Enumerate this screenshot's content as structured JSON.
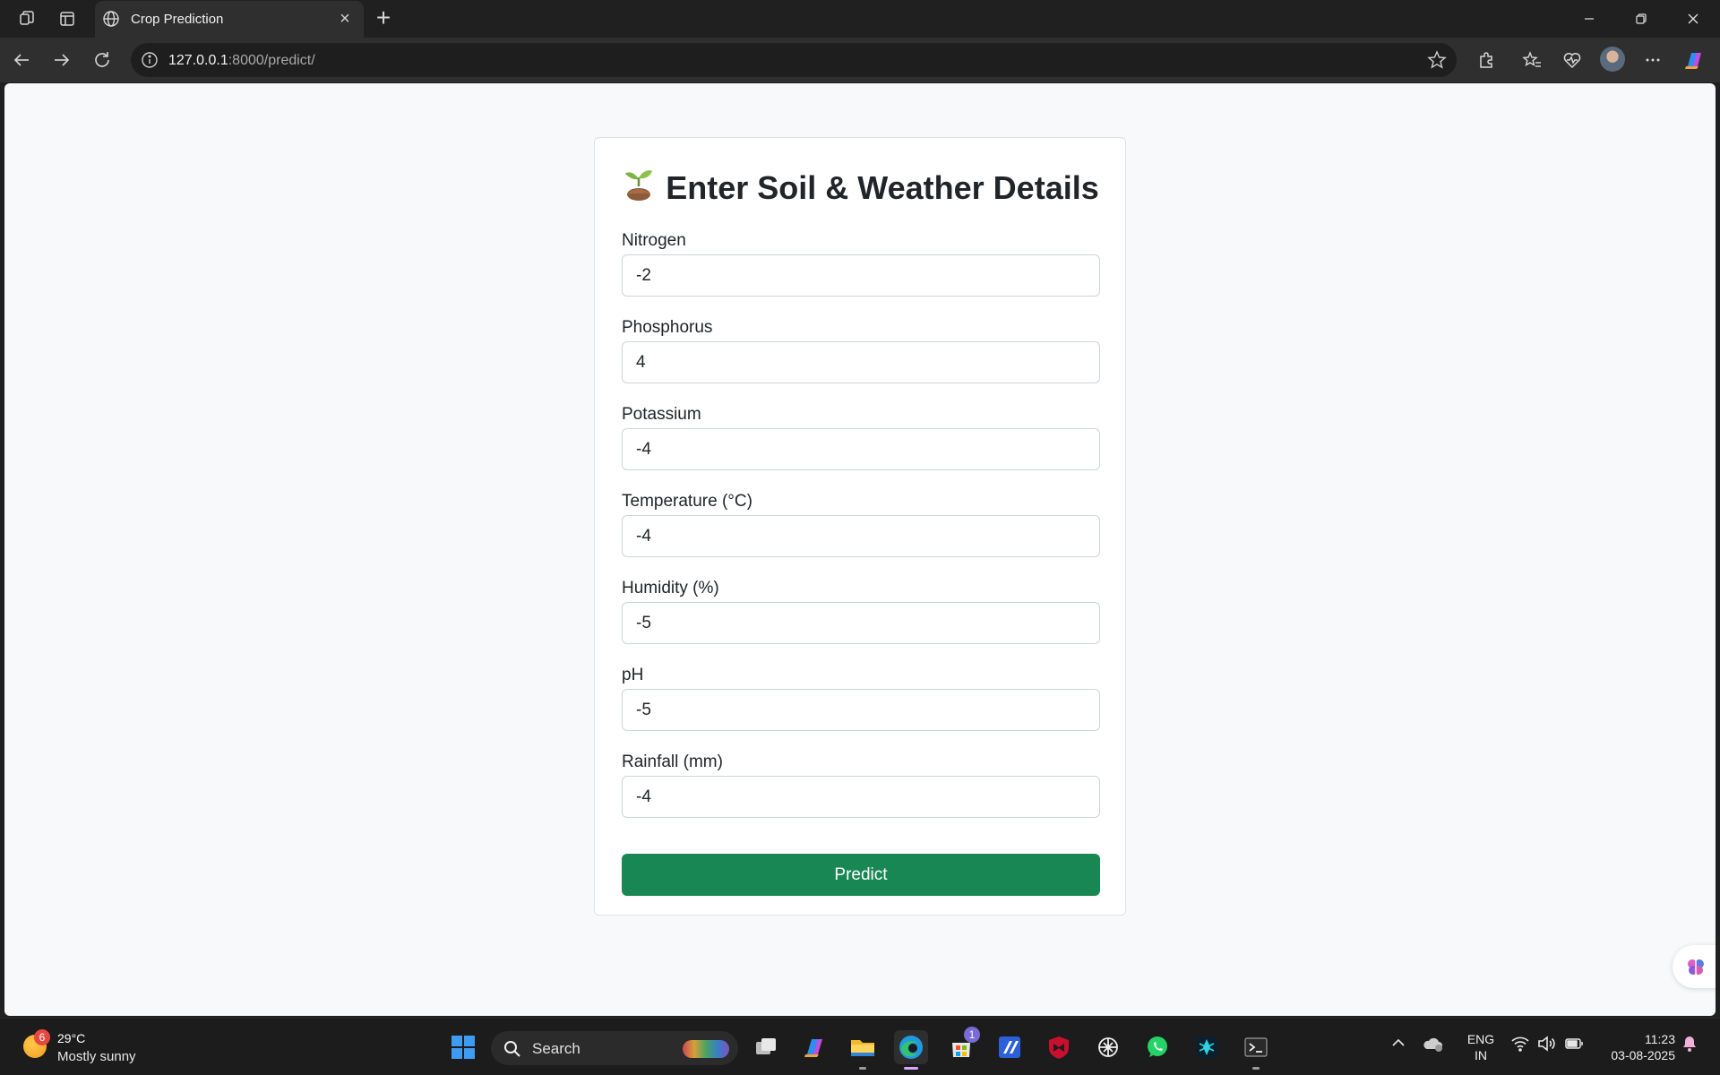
{
  "browser": {
    "tab_title": "Crop Prediction",
    "url_host": "127.0.0.1",
    "url_path": ":8000/predict/"
  },
  "form": {
    "title": "Enter Soil & Weather Details",
    "fields": [
      {
        "label": "Nitrogen",
        "value": "-2"
      },
      {
        "label": "Phosphorus",
        "value": "4"
      },
      {
        "label": "Potassium",
        "value": "-4"
      },
      {
        "label": "Temperature (°C)",
        "value": "-4"
      },
      {
        "label": "Humidity (%)",
        "value": "-5"
      },
      {
        "label": "pH",
        "value": "-5"
      },
      {
        "label": "Rainfall (mm)",
        "value": "-4"
      }
    ],
    "submit_label": "Predict",
    "submit_color": "#198754"
  },
  "taskbar": {
    "weather_badge": "6",
    "weather_temp": "29°C",
    "weather_condition": "Mostly sunny",
    "search_label": "Search",
    "store_badge": "1",
    "lang_line1": "ENG",
    "lang_line2": "IN",
    "time": "11:23",
    "date": "03-08-2025"
  }
}
